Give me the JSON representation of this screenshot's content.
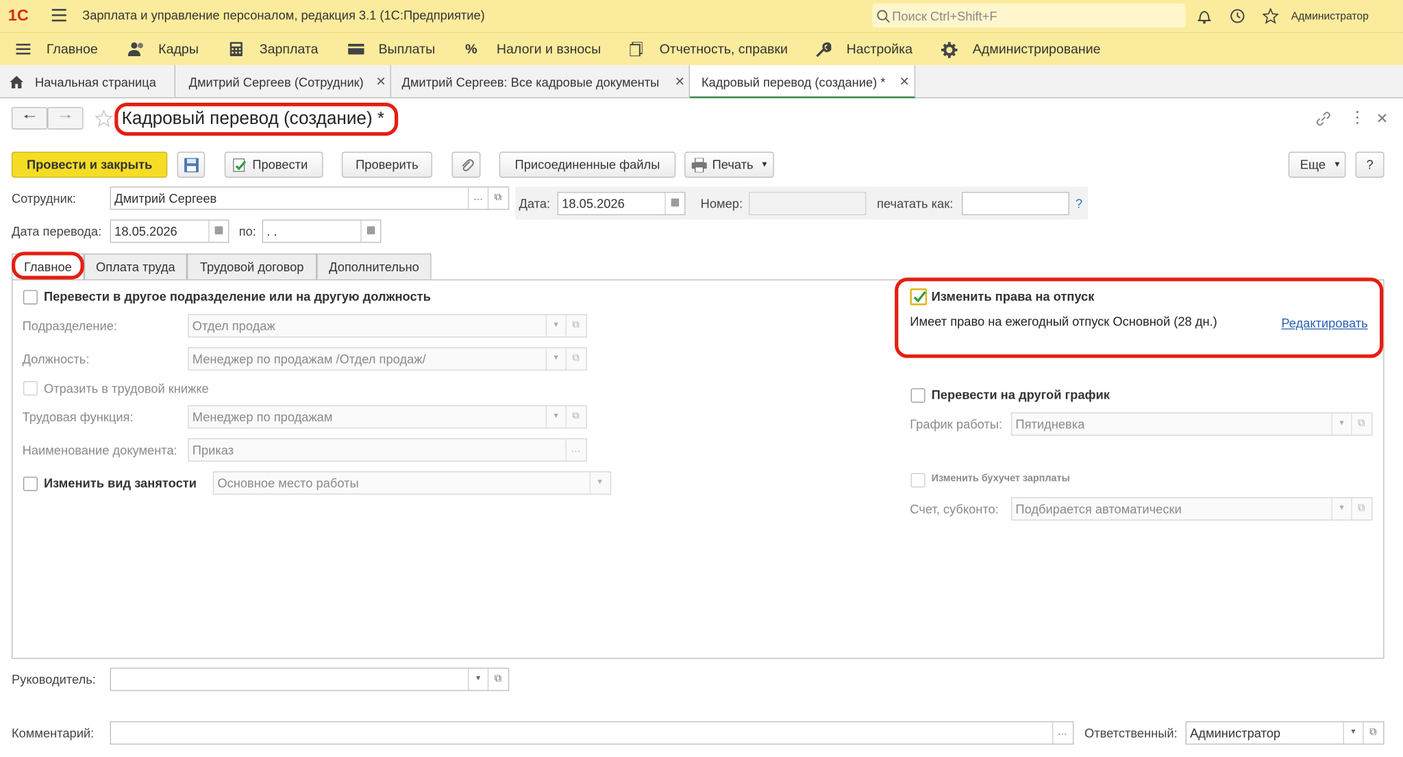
{
  "app": {
    "logo": "1С",
    "title": "Зарплата и управление персоналом, редакция 3.1  (1С:Предприятие)",
    "search_placeholder": "Поиск Ctrl+Shift+F",
    "user": "Администратор"
  },
  "menu": [
    "Главное",
    "Кадры",
    "Зарплата",
    "Выплаты",
    "Налоги и взносы",
    "Отчетность, справки",
    "Настройка",
    "Администрирование"
  ],
  "open_tabs": [
    {
      "label": "Начальная страница"
    },
    {
      "label": "Дмитрий Сергеев (Сотрудник)"
    },
    {
      "label": "Дмитрий Сергеев: Все кадровые документы"
    },
    {
      "label": "Кадровый перевод (создание) *"
    }
  ],
  "form": {
    "title": "Кадровый перевод (создание) *",
    "buttons": {
      "post_close": "Провести и закрыть",
      "post": "Провести",
      "check": "Проверить",
      "attached": "Присоединенные файлы",
      "print": "Печать",
      "more": "Еще",
      "help": "?"
    },
    "employee_label": "Сотрудник:",
    "employee": "Дмитрий Сергеев",
    "date_label": "Дата:",
    "date": "18.05.2026",
    "number_label": "Номер:",
    "number": "",
    "print_as_label": "печатать как:",
    "print_as": "",
    "print_as_hint": "?",
    "transfer_date_label": "Дата перевода:",
    "transfer_date": "18.05.2026",
    "to_label": "по:",
    "to_date": " .  .",
    "tabs": [
      "Главное",
      "Оплата труда",
      "Трудовой договор",
      "Дополнительно"
    ],
    "main": {
      "transfer_dept_check": "Перевести в другое подразделение или на другую должность",
      "dept_label": "Подразделение:",
      "dept": "Отдел продаж",
      "position_label": "Должность:",
      "position": "Менеджер по продажам /Отдел продаж/",
      "workbook_check": "Отразить в трудовой книжке",
      "labor_func_label": "Трудовая функция:",
      "labor_func": "Менеджер по продажам",
      "doc_name_label": "Наименование документа:",
      "doc_name": "Приказ",
      "employment_check": "Изменить вид занятости",
      "employment": "Основное место работы",
      "vacation_check": "Изменить права на отпуск",
      "vacation_checked": true,
      "vacation_text": "Имеет право на ежегодный отпуск Основной (28 дн.)",
      "edit_link": "Редактировать",
      "schedule_check": "Перевести на другой график",
      "schedule_label": "График работы:",
      "schedule": "Пятидневка",
      "accounting_check": "Изменить бухучет зарплаты",
      "account_label": "Счет, субконто:",
      "account": "Подбирается автоматически"
    },
    "manager_label": "Руководитель:",
    "manager": "",
    "comment_label": "Комментарий:",
    "comment": "",
    "responsible_label": "Ответственный:",
    "responsible": "Администратор"
  },
  "colors": {
    "toolbar": "#fbec9d",
    "primary_button": "#f5dd26",
    "highlight": "#e51e12",
    "link": "#2a5fb0"
  }
}
